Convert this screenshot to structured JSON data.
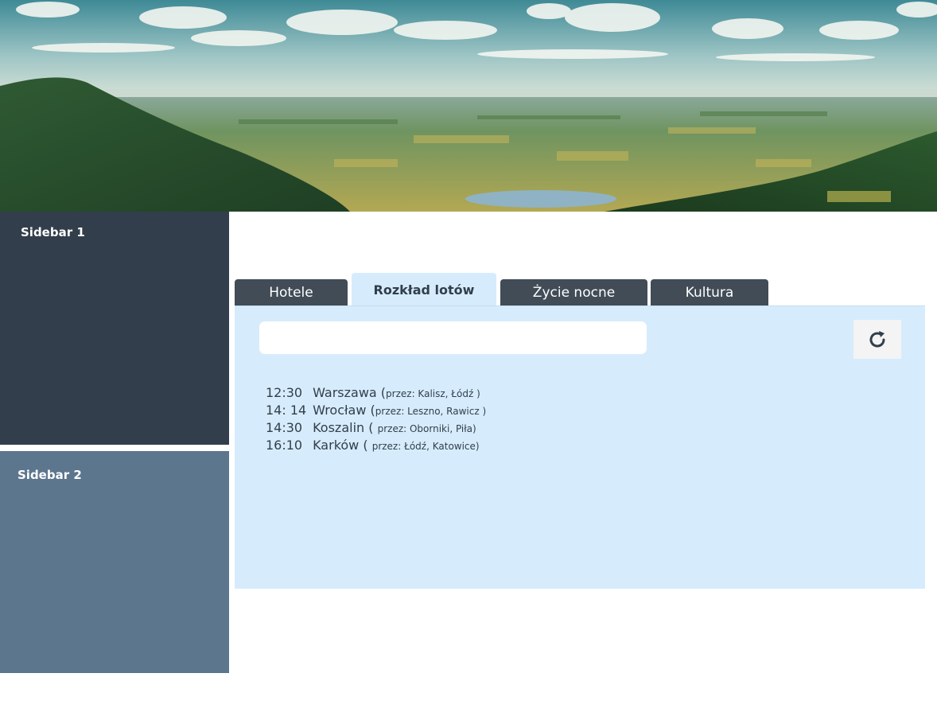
{
  "header": {
    "banner_image": "landscape-photo"
  },
  "sidebar1": {
    "title": "Sidebar 1",
    "background": "#323e4b"
  },
  "sidebar2": {
    "title": "Sidebar 2",
    "background": "#5c768e"
  },
  "tabs": [
    {
      "label": "Hotele",
      "active": false
    },
    {
      "label": "Rozkład lotów",
      "active": true
    },
    {
      "label": "Życie nocne",
      "active": false
    },
    {
      "label": "Kultura",
      "active": false
    }
  ],
  "panel": {
    "search": {
      "value": "",
      "placeholder": ""
    },
    "refresh_icon": "refresh-icon",
    "flights": [
      {
        "time": "12:30",
        "city": "Warszawa",
        "via_open": "(",
        "via": "przez: Kalisz, Łódź )"
      },
      {
        "time": "14: 14",
        "city": "Wrocław",
        "via_open": "(",
        "via": "przez: Leszno, Rawicz )"
      },
      {
        "time": "14:30",
        "city": "Koszalin",
        "via_open": "(",
        "via": "przez: Oborniki, Piła)"
      },
      {
        "time": "16:10",
        "city": "Karków",
        "via_open": "(",
        "via": "przez: Łódź, Katowice)"
      }
    ]
  },
  "colors": {
    "tab_inactive": "#414c57",
    "tab_active": "#d6ecfd",
    "panel_background": "#d6ecfd",
    "text_dark": "#323e4b"
  }
}
